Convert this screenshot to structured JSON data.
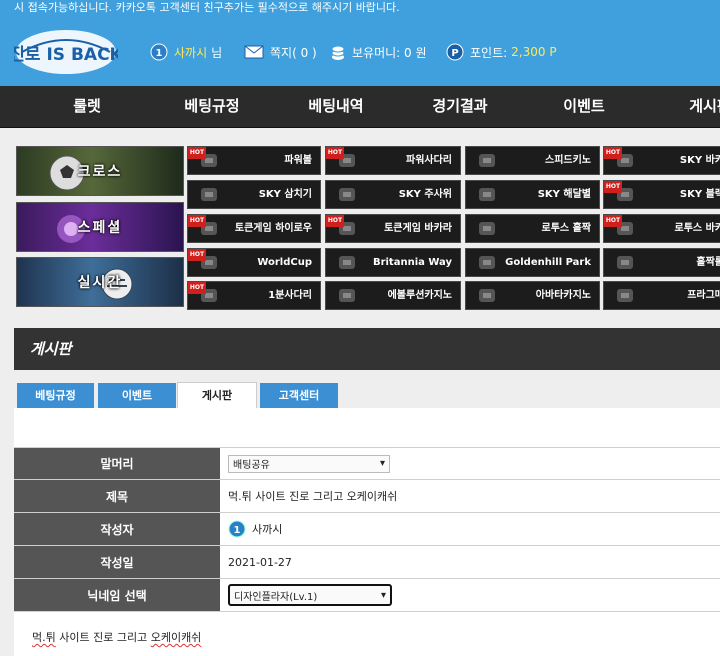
{
  "header": {
    "notice": "시 접속가능하십니다. 카카오톡 고객센터 친구추가는 필수적으로 해주시기 바랍니다.",
    "logo_text": "진로 IS BACK",
    "user_level": "1",
    "username": "사까시",
    "user_suffix": "님",
    "message_label": "쪽지( 0 )",
    "money_label": "보유머니: 0 원",
    "points_label": "포인트:",
    "points_value": "2,300 P",
    "colors": {
      "bg": "#3fa0dd",
      "highlight": "#ffe95a"
    }
  },
  "nav": {
    "items": [
      "룰렛",
      "베팅규정",
      "베팅내역",
      "경기결과",
      "이벤트",
      "게시판"
    ]
  },
  "categories": [
    {
      "label": "크로스",
      "icon": "soccer-ball-image"
    },
    {
      "label": "스페셜",
      "icon": "special-image"
    },
    {
      "label": "실시간",
      "icon": "live-image"
    }
  ],
  "games": [
    {
      "label": "파워볼",
      "hot": true,
      "icon": "powerball-icon"
    },
    {
      "label": "파워사다리",
      "hot": true,
      "icon": "ladder-icon"
    },
    {
      "label": "스피드키노",
      "hot": false,
      "icon": "keno-icon"
    },
    {
      "label": "SKY 바카",
      "hot": true,
      "icon": "sky-icon"
    },
    {
      "label": "SKY 삼치기",
      "hot": false,
      "icon": "sky-icon"
    },
    {
      "label": "SKY 주사위",
      "hot": false,
      "icon": "dice-icon"
    },
    {
      "label": "SKY 해달별",
      "hot": false,
      "icon": "sky-icon"
    },
    {
      "label": "SKY 블랙",
      "hot": true,
      "icon": "sky-icon"
    },
    {
      "label": "토큰게임 하이로우",
      "hot": true,
      "icon": "token-icon"
    },
    {
      "label": "토큰게임 바카라",
      "hot": true,
      "icon": "token-icon"
    },
    {
      "label": "로투스 홀짝",
      "hot": false,
      "icon": "lotus-icon"
    },
    {
      "label": "로투스 바카",
      "hot": true,
      "icon": "lotus-icon"
    },
    {
      "label": "WorldCup",
      "hot": true,
      "icon": "bet365-icon"
    },
    {
      "label": "Britannia Way",
      "hot": false,
      "icon": "bet365-icon"
    },
    {
      "label": "Goldenhill Park",
      "hot": false,
      "icon": "bet365-icon"
    },
    {
      "label": "홀짝롤",
      "hot": false,
      "icon": "script-icon"
    },
    {
      "label": "1분사다리",
      "hot": true,
      "icon": "script-icon"
    },
    {
      "label": "에볼루션카지노",
      "hot": false,
      "icon": "evolution-icon"
    },
    {
      "label": "아바타카지노",
      "hot": false,
      "icon": "avatar-icon"
    },
    {
      "label": "프라그매",
      "hot": false,
      "icon": "play-icon"
    }
  ],
  "board": {
    "title": "게시판",
    "tabs": [
      {
        "label": "베팅규정",
        "active": false
      },
      {
        "label": "이벤트",
        "active": false
      },
      {
        "label": "게시판",
        "active": true
      },
      {
        "label": "고객센터",
        "active": false
      }
    ]
  },
  "form": {
    "header_label": "말머리",
    "header_value": "배팅공유",
    "subject_label": "제목",
    "subject_value": "먹.튀 사이트 진로 그리고 오케이캐쉬",
    "author_label": "작성자",
    "author_name": "사까시",
    "author_level": "1",
    "date_label": "작성일",
    "date_value": "2021-01-27",
    "nickname_label": "닉네임 선택",
    "nickname_value": "디자인플라자(Lv.1)",
    "body_prefix": "먹.튀",
    "body_middle": " 사이트 진로 그리고 ",
    "body_suffix": "오케이캐쉬"
  }
}
